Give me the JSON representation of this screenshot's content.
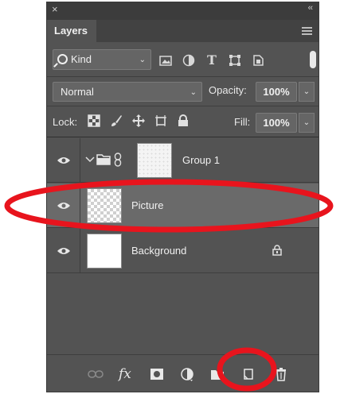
{
  "panel": {
    "title": "Layers",
    "close_glyph": "×",
    "collapse_glyph": "‹‹"
  },
  "filter": {
    "kind_label": "Kind",
    "icons": [
      "image-filter-icon",
      "adjustment-filter-icon",
      "type-filter-icon",
      "shape-filter-icon",
      "smart-object-filter-icon"
    ],
    "type_glyph": "T"
  },
  "blend": {
    "mode": "Normal",
    "opacity_label": "Opacity:",
    "opacity_value": "100%"
  },
  "lock": {
    "label": "Lock:",
    "icons": [
      "lock-transparent-icon",
      "lock-image-icon",
      "lock-position-icon",
      "lock-artboard-icon",
      "lock-all-icon"
    ],
    "fill_label": "Fill:",
    "fill_value": "100%"
  },
  "layers": [
    {
      "name": "Group 1",
      "type": "group",
      "visible": true,
      "selected": false
    },
    {
      "name": "Picture",
      "type": "pixel",
      "visible": true,
      "selected": true
    },
    {
      "name": "Background",
      "type": "background",
      "visible": true,
      "locked": true,
      "selected": false
    }
  ],
  "bottom": {
    "fx_label": "fx",
    "icons": [
      "link-layers-icon",
      "fx-icon",
      "add-mask-icon",
      "adjustment-layer-icon",
      "new-group-icon",
      "new-layer-icon",
      "delete-layer-icon"
    ]
  },
  "colors": {
    "panel_bg": "#535353",
    "selected_row": "#6a6a6a",
    "annotation": "#e8141d"
  }
}
